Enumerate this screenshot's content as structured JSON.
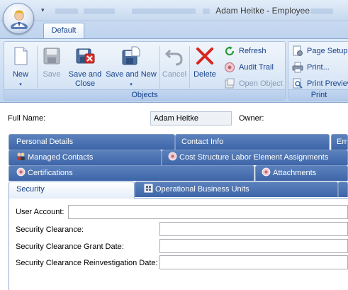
{
  "window": {
    "title": "Adam Heitke - Employee"
  },
  "ribbon": {
    "tab_label": "Default",
    "objects": {
      "group_label": "Objects",
      "new": "New",
      "save": "Save",
      "save_and_close": "Save and Close",
      "save_and_new": "Save and New",
      "cancel": "Cancel",
      "delete": "Delete",
      "refresh": "Refresh",
      "audit_trail": "Audit Trail",
      "open_object": "Open Object"
    },
    "print": {
      "group_label": "Print",
      "page_setup": "Page Setup...",
      "print": "Print...",
      "print_preview": "Print Preview"
    }
  },
  "header": {
    "full_name_label": "Full Name:",
    "full_name_value": "Adam Heitke",
    "owner_label": "Owner:"
  },
  "detail_tabs": {
    "personal_details": "Personal Details",
    "contact_info": "Contact Info",
    "emp": "Emp",
    "managed_contacts": "Managed Contacts",
    "cost_structure": "Cost Structure Labor Element Assignments",
    "certifications": "Certifications",
    "attachments": "Attachments",
    "security": "Security",
    "operational_units": "Operational Business Units"
  },
  "security_form": {
    "user_account_label": "User Account:",
    "user_account_value": "",
    "clearance_label": "Security Clearance:",
    "clearance_value": "",
    "grant_date_label": "Security Clearance Grant Date:",
    "grant_date_value": "",
    "reinvestigation_label": "Security Clearance Reinvestigation Date:",
    "reinvestigation_value": ""
  }
}
